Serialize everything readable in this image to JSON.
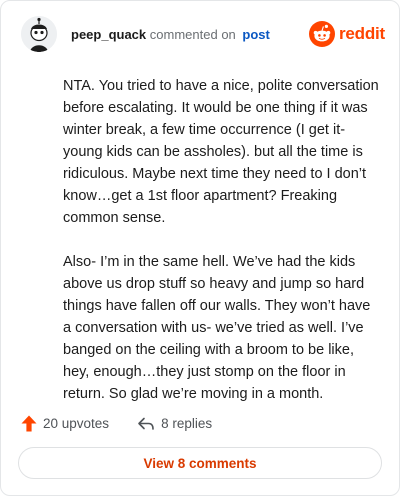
{
  "comment": {
    "username": "peep_quack",
    "action_text": "commented on",
    "post_link": "post",
    "paragraphs": [
      "NTA. You tried to have a nice, polite conversation before escalating. It would be one thing if it was winter break, a few time occurrence (I get it- young kids can be assholes). but all the time is ridiculous. Maybe next time they need to I don’t know…get a 1st floor apartment? Freaking common sense.",
      "Also- I’m in the same hell. We’ve had the kids above us drop stuff so heavy and jump so hard things have fallen off our walls. They won’t have a conversation with us- we’ve tried as well. I’ve banged on the ceiling with a broom to be like, hey, enough…they just stomp on the floor in return. So glad we’re moving in a month."
    ]
  },
  "brand": {
    "name": "reddit",
    "icon": "reddit-logo-icon",
    "color": "#ff4500"
  },
  "actions": {
    "upvotes_label": "20 upvotes",
    "upvote_icon": "upvote-arrow-icon",
    "upvote_color": "#ff4500",
    "replies_label": "8 replies",
    "reply_icon": "reply-arrow-icon"
  },
  "view_comments_label": "View 8 comments",
  "accent_color": "#d93a00"
}
